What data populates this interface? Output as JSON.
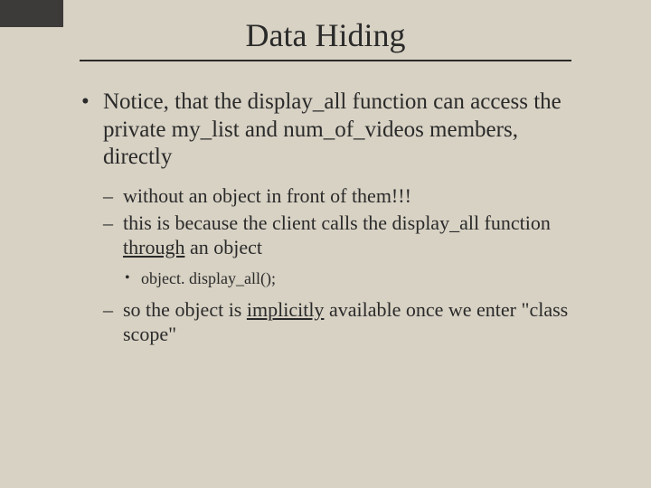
{
  "title": "Data Hiding",
  "bullet1_a": "Notice, that the display_all function can access the private my_list and num_of_videos members, directly",
  "sub1": "without an object in front of them!!!",
  "sub2_a": "this is because the client calls the display_all function ",
  "sub2_u": "through",
  "sub2_b": " an object",
  "code1": "object. display_all();",
  "sub3_a": "so the object is ",
  "sub3_u": "implicitly",
  "sub3_b": " available once we enter \"class scope\""
}
